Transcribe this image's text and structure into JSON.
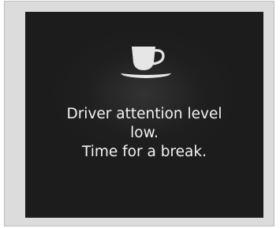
{
  "alert": {
    "icon": "coffee-cup-icon",
    "message_lines": [
      "Driver attention level",
      "low.",
      "Time for a break."
    ]
  },
  "colors": {
    "screen_background": "#1c1c1c",
    "frame_background": "#dcdcdc",
    "text": "#f2f2f2",
    "icon": "#e6e6e6"
  }
}
